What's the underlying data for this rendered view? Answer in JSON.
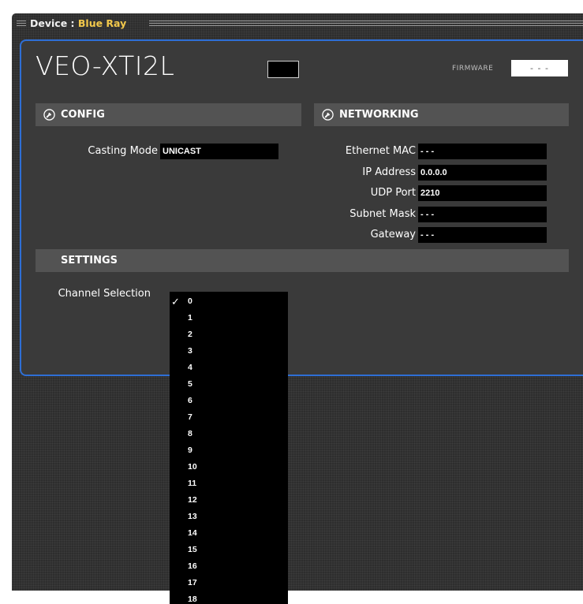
{
  "device": {
    "label": "Device :",
    "name": "Blue Ray"
  },
  "model": "VEO-XTI2L",
  "firmware": {
    "label": "FIRMWARE",
    "value": "- - -"
  },
  "config": {
    "title": "CONFIG",
    "casting_mode": {
      "label": "Casting Mode",
      "value": "UNICAST"
    }
  },
  "networking": {
    "title": "NETWORKING",
    "fields": [
      {
        "label": "Ethernet MAC",
        "value": "- - -"
      },
      {
        "label": "IP Address",
        "value": "0.0.0.0"
      },
      {
        "label": "UDP Port",
        "value": "2210"
      },
      {
        "label": "Subnet Mask",
        "value": "- - -"
      },
      {
        "label": "Gateway",
        "value": "- - -"
      }
    ]
  },
  "settings": {
    "title": "SETTINGS",
    "channel_selection": {
      "label": "Channel Selection",
      "selected": "0",
      "options": [
        "0",
        "1",
        "2",
        "3",
        "4",
        "5",
        "6",
        "7",
        "8",
        "9",
        "10",
        "11",
        "12",
        "13",
        "14",
        "15",
        "16",
        "17",
        "18"
      ]
    }
  },
  "colors": {
    "accent_border": "#2e6fd6",
    "device_name": "#f2c84b"
  }
}
